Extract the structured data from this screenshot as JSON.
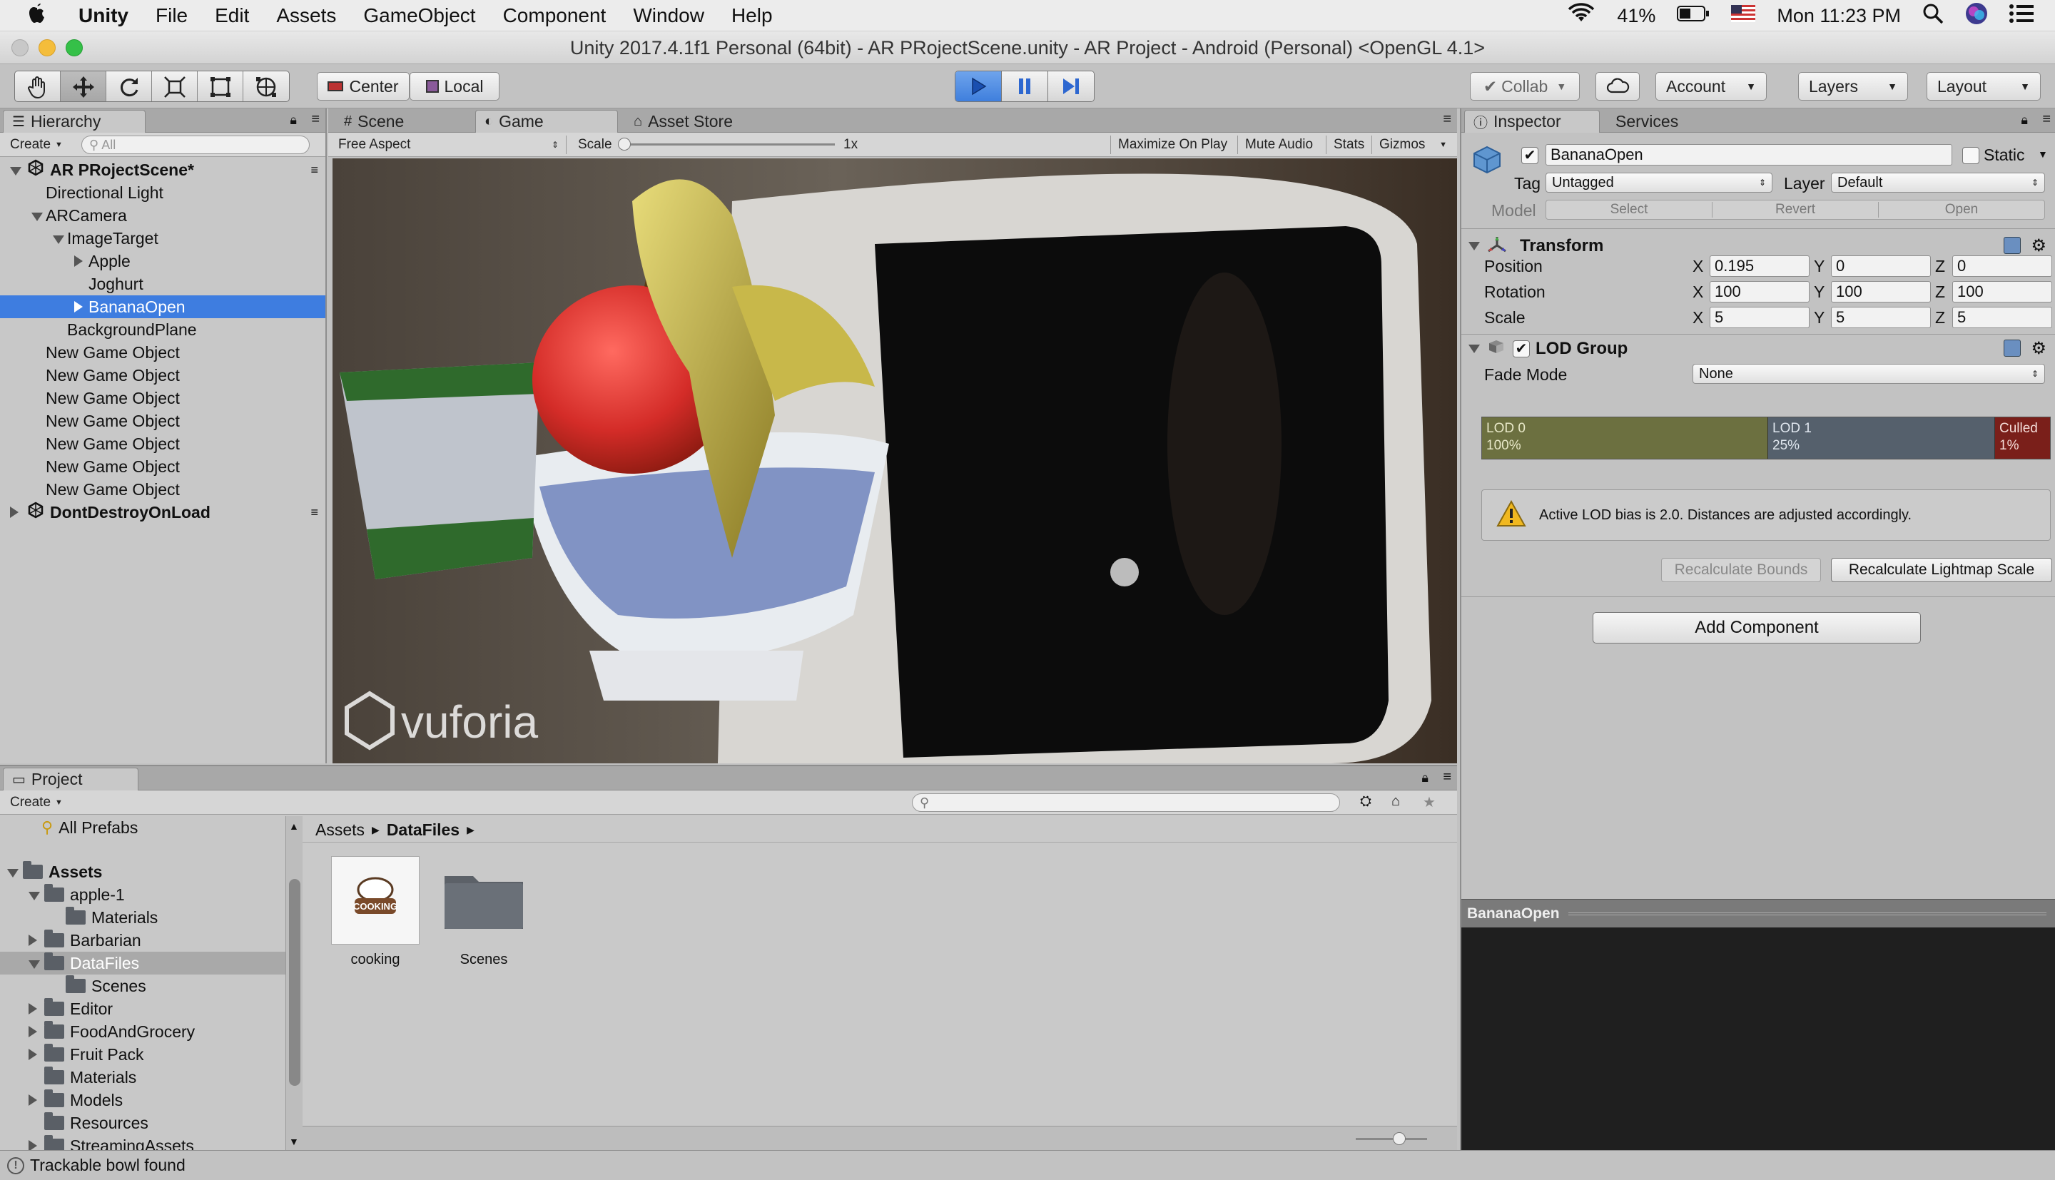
{
  "menubar": {
    "app": "Unity",
    "items": [
      "File",
      "Edit",
      "Assets",
      "GameObject",
      "Component",
      "Window",
      "Help"
    ],
    "battery": "41%",
    "clock": "Mon 11:23 PM"
  },
  "window": {
    "title": "Unity 2017.4.1f1 Personal (64bit) - AR PRojectScene.unity - AR Project - Android (Personal) <OpenGL 4.1>"
  },
  "toolbar": {
    "pivot": "Center",
    "space": "Local",
    "collab": "Collab",
    "account": "Account",
    "layers": "Layers",
    "layout": "Layout"
  },
  "hierarchy": {
    "tab": "Hierarchy",
    "create": "Create",
    "search_placeholder": "All",
    "rows": [
      {
        "label": "AR PRojectScene*",
        "indent": 0,
        "arrow": "down",
        "scene": true
      },
      {
        "label": "Directional Light",
        "indent": 1,
        "arrow": "none"
      },
      {
        "label": "ARCamera",
        "indent": 1,
        "arrow": "down"
      },
      {
        "label": "ImageTarget",
        "indent": 2,
        "arrow": "down"
      },
      {
        "label": "Apple",
        "indent": 3,
        "arrow": "right"
      },
      {
        "label": "Joghurt",
        "indent": 3,
        "arrow": "none"
      },
      {
        "label": "BananaOpen",
        "indent": 3,
        "arrow": "right",
        "selected": true
      },
      {
        "label": "BackgroundPlane",
        "indent": 2,
        "arrow": "none"
      },
      {
        "label": "New Game Object",
        "indent": 1,
        "arrow": "none"
      },
      {
        "label": "New Game Object",
        "indent": 1,
        "arrow": "none"
      },
      {
        "label": "New Game Object",
        "indent": 1,
        "arrow": "none"
      },
      {
        "label": "New Game Object",
        "indent": 1,
        "arrow": "none"
      },
      {
        "label": "New Game Object",
        "indent": 1,
        "arrow": "none"
      },
      {
        "label": "New Game Object",
        "indent": 1,
        "arrow": "none"
      },
      {
        "label": "New Game Object",
        "indent": 1,
        "arrow": "none"
      },
      {
        "label": "DontDestroyOnLoad",
        "indent": 0,
        "arrow": "right",
        "scene": true
      }
    ]
  },
  "game": {
    "tabs": [
      "Scene",
      "Game",
      "Asset Store"
    ],
    "aspect": "Free Aspect",
    "scale_label": "Scale",
    "scale_value": "1x",
    "buttons": [
      "Maximize On Play",
      "Mute Audio",
      "Stats",
      "Gizmos"
    ],
    "watermark": "vuforia"
  },
  "inspector": {
    "tabs": [
      "Inspector",
      "Services"
    ],
    "object_name": "BananaOpen",
    "static_label": "Static",
    "tag_label": "Tag",
    "tag_value": "Untagged",
    "layer_label": "Layer",
    "layer_value": "Default",
    "model_label": "Model",
    "model_buttons": [
      "Select",
      "Revert",
      "Open"
    ],
    "transform": {
      "title": "Transform",
      "rows": [
        {
          "label": "Position",
          "x": "0.195",
          "y": "0",
          "z": "0"
        },
        {
          "label": "Rotation",
          "x": "100",
          "y": "100",
          "z": "100"
        },
        {
          "label": "Scale",
          "x": "5",
          "y": "5",
          "z": "5"
        }
      ]
    },
    "lod": {
      "title": "LOD Group",
      "fade_label": "Fade Mode",
      "fade_value": "None",
      "bars": [
        {
          "name": "LOD 0",
          "pct": "100%"
        },
        {
          "name": "LOD 1",
          "pct": "25%"
        },
        {
          "name": "Culled",
          "pct": "1%"
        }
      ],
      "warning": "Active LOD bias is 2.0. Distances are adjusted accordingly.",
      "recalc_bounds": "Recalculate Bounds",
      "recalc_lightmap": "Recalculate Lightmap Scale"
    },
    "add_component": "Add Component",
    "preview_title": "BananaOpen"
  },
  "project": {
    "tab": "Project",
    "create": "Create",
    "favorites": "All Prefabs",
    "tree": [
      {
        "label": "Assets",
        "indent": 0,
        "arrow": "down",
        "bold": true
      },
      {
        "label": "apple-1",
        "indent": 1,
        "arrow": "down"
      },
      {
        "label": "Materials",
        "indent": 2,
        "arrow": "none"
      },
      {
        "label": "Barbarian",
        "indent": 1,
        "arrow": "right"
      },
      {
        "label": "DataFiles",
        "indent": 1,
        "arrow": "down",
        "selected": true
      },
      {
        "label": "Scenes",
        "indent": 2,
        "arrow": "none"
      },
      {
        "label": "Editor",
        "indent": 1,
        "arrow": "right"
      },
      {
        "label": "FoodAndGrocery",
        "indent": 1,
        "arrow": "right"
      },
      {
        "label": "Fruit Pack",
        "indent": 1,
        "arrow": "right"
      },
      {
        "label": "Materials",
        "indent": 1,
        "arrow": "none"
      },
      {
        "label": "Models",
        "indent": 1,
        "arrow": "right"
      },
      {
        "label": "Resources",
        "indent": 1,
        "arrow": "none"
      },
      {
        "label": "StreamingAssets",
        "indent": 1,
        "arrow": "right"
      }
    ],
    "breadcrumb": [
      "Assets",
      "DataFiles"
    ],
    "items": [
      {
        "label": "cooking",
        "type": "image"
      },
      {
        "label": "Scenes",
        "type": "folder"
      }
    ]
  },
  "status": {
    "message": "Trackable bowl found"
  }
}
